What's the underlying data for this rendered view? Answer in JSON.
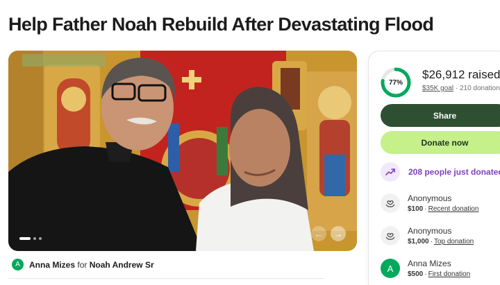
{
  "page": {
    "title": "Help Father Noah Rebuild After Devastating Flood"
  },
  "hero": {
    "slide_count": 3,
    "active_slide": 1,
    "prev_label": "←",
    "next_label": "→"
  },
  "organizer": {
    "avatar_letter": "A",
    "name": "Anna Mizes",
    "connector": "for",
    "beneficiary": "Noah Andrew Sr"
  },
  "donation": {
    "progress_percent": 77,
    "progress_label": "77%",
    "raised": "$26,912 raised",
    "goal": "$35K goal",
    "separator": "·",
    "donation_count": "210 donations",
    "share_label": "Share",
    "donate_label": "Donate now",
    "just_donated": "208 people just donated",
    "donors": [
      {
        "name": "Anonymous",
        "amount": "$100",
        "tag": "Recent donation",
        "icon": "heart-hands-icon"
      },
      {
        "name": "Anonymous",
        "amount": "$1,000",
        "tag": "Top donation",
        "icon": "heart-hands-icon"
      },
      {
        "name": "Anna Mizes",
        "amount": "$500",
        "tag": "First donation",
        "icon": "A"
      }
    ]
  },
  "colors": {
    "brand_green": "#02a95c",
    "share_bg": "#2f4f32",
    "donate_bg": "#c5f08a",
    "purple": "#7f3fbf"
  }
}
